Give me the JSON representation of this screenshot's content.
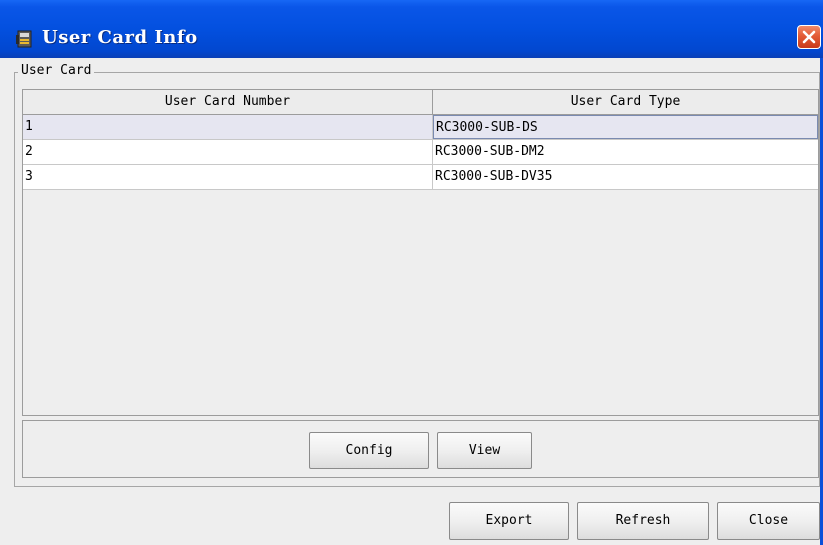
{
  "window": {
    "title": "User Card Info",
    "title_bar_color": "#0350df",
    "close_button_color": "#e35b36"
  },
  "group": {
    "label": "User Card"
  },
  "table": {
    "headers": [
      "User Card Number",
      "User Card Type"
    ],
    "rows": [
      {
        "number": "1",
        "type": "RC3000-SUB-DS"
      },
      {
        "number": "2",
        "type": "RC3000-SUB-DM2"
      },
      {
        "number": "3",
        "type": "RC3000-SUB-DV35"
      }
    ],
    "selected_row": 1
  },
  "panel_buttons": {
    "config_label": "Config",
    "view_label": "View"
  },
  "footer_buttons": {
    "export_label": "Export",
    "refresh_label": "Refresh",
    "close_label": "Close"
  }
}
